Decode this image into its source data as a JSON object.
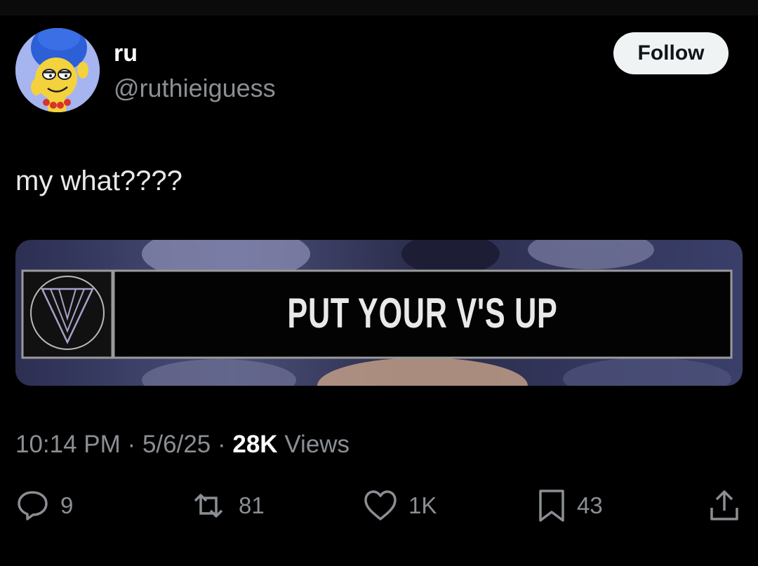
{
  "header": {
    "display_name": "ru",
    "handle": "@ruthieiguess",
    "follow_label": "Follow"
  },
  "tweet": {
    "text": "my what????",
    "media": {
      "caption": "PUT YOUR V'S UP"
    },
    "time": "10:14 PM",
    "separator": "·",
    "date": "5/6/25",
    "views_count": "28K",
    "views_label": "Views"
  },
  "actions": {
    "replies": "9",
    "reposts": "81",
    "likes": "1K",
    "bookmarks": "43"
  },
  "colors": {
    "background": "#000000",
    "text_primary": "#e7e9ea",
    "text_secondary": "#8b8f94",
    "follow_button_bg": "#eff3f4",
    "follow_button_text": "#0f1419"
  },
  "icons": [
    "reply-icon",
    "repost-icon",
    "like-icon",
    "bookmark-icon",
    "share-icon"
  ]
}
